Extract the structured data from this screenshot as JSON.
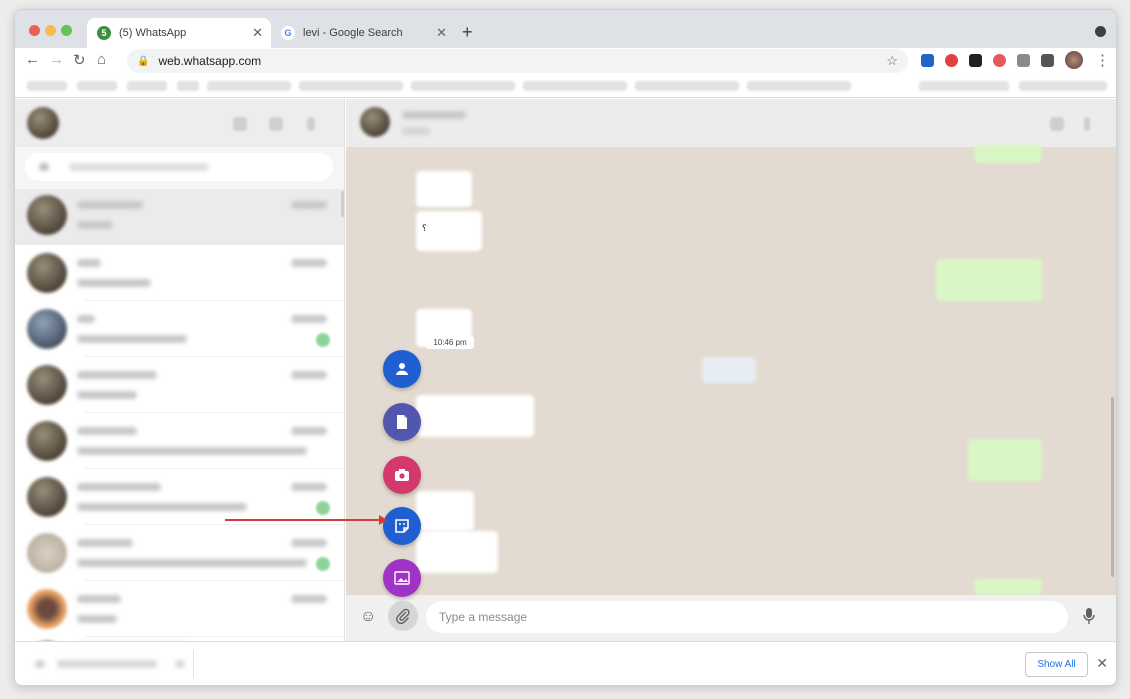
{
  "browser": {
    "tabs": [
      {
        "title": "(5) WhatsApp",
        "favicon": "whatsapp-icon",
        "active": true
      },
      {
        "title": "levi - Google Search",
        "favicon": "google-icon",
        "active": false
      }
    ],
    "url": "web.whatsapp.com",
    "traffic_colors": [
      "#ec5f59",
      "#f5bd4f",
      "#61c454"
    ]
  },
  "whatsapp": {
    "composer_placeholder": "Type a message",
    "visible_time": "10:46 pm",
    "attach_menu": [
      {
        "name": "contact",
        "icon": "person-icon",
        "color": "#1f5fd1"
      },
      {
        "name": "document",
        "icon": "document-icon",
        "color": "#5157ae"
      },
      {
        "name": "camera",
        "icon": "camera-icon",
        "color": "#d3396d"
      },
      {
        "name": "sticker",
        "icon": "sticker-icon",
        "color": "#1f5fd1"
      },
      {
        "name": "photos",
        "icon": "image-icon",
        "color": "#a033c7"
      }
    ],
    "highlight_color": "#d83a3a"
  },
  "downloads": {
    "show_all_label": "Show All"
  }
}
